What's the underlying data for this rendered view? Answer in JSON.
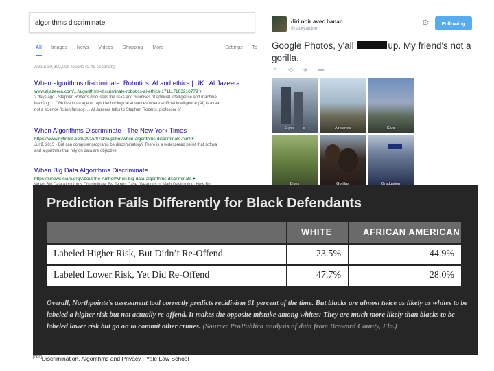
{
  "search": {
    "query": "algorithms discriminate",
    "tabs": [
      "All",
      "Images",
      "News",
      "Videos",
      "Shopping",
      "More"
    ],
    "settings_label": "Settings",
    "tools_label": "To",
    "result_count": "About 30,800,000 results (0.49 seconds)",
    "results": [
      {
        "title": "When algorithms discriminate: Robotics, AI and ethics | UK | Al Jazeera",
        "url": "www.aljazeera.com/.../algorithms-discriminate-robotics-ai-ethics-171117103216779 ▾",
        "snippet_1": "2 days ago - Stephen Roberts discusses the risks and promises of artificial intelligence and machine",
        "snippet_2": "learning. ... \"We live in an age of rapid technological advances where artificial intelligence (AI) is a real",
        "snippet_3": "not a science fiction fantasy. ... Al Jazeera talks to Stephen Roberts, professor of"
      },
      {
        "title": "When Algorithms Discriminate - The New York Times",
        "url": "https://www.nytimes.com/2015/07/10/upshot/when-algorithms-discriminate.html ▾",
        "snippet_1": "Jul 9, 2015 - But can computer programs be discriminatory? There is a widespread belief that softwa",
        "snippet_2": "and algorithms that rely on data are objective.",
        "snippet_3": ""
      },
      {
        "title": "When Big Data Algorithms Discriminate",
        "url": "https://sinews.siam.org/About-the-Author/when-big-data-algorithms-discriminate ▾",
        "snippet_1": "When Big Data Algorithms Discriminate. By James Case. Weapons of Math Destruction: How Big",
        "snippet_2": "",
        "snippet_3": ""
      }
    ]
  },
  "tweet": {
    "name": "diri noir avec banan",
    "handle": "@jackyalcine",
    "follow_label": "Following",
    "text_before": "Google Photos, y'all",
    "text_after": "up. My friend's not a gorilla.",
    "actions": [
      "↰",
      "⟲",
      "★",
      "•••"
    ],
    "photos": [
      {
        "label": "Skyscrapers"
      },
      {
        "label": "Airplanes"
      },
      {
        "label": "Cars"
      },
      {
        "label": "Bikes"
      },
      {
        "label": "Gorillas"
      },
      {
        "label": "Graduation"
      }
    ]
  },
  "propublica": {
    "title": "Prediction Fails Differently for Black Defendants",
    "headers": [
      "",
      "WHITE",
      "AFRICAN AMERICAN"
    ],
    "rows": [
      {
        "label": "Labeled Higher Risk, But Didn’t Re-Offend",
        "white": "23.5%",
        "african_american": "44.9%"
      },
      {
        "label": "Labeled Lower Risk, Yet Did Re-Offend",
        "white": "47.7%",
        "african_american": "28.0%"
      }
    ],
    "note": "Overall, Northpointe’s assessment tool correctly predicts recidivism 61 percent of the time. But blacks are almost twice as likely as whites to be labeled a higher risk but not actually re-offend. It makes the opposite mistake among whites: They are much more likely than blacks to be labeled lower risk but go on to commit other crimes.",
    "source": "(Source: ProPublica analysis of data from Broward County, Fla.)"
  },
  "footer": {
    "sup": "[PDF]",
    "text": "Discrimination, Algorithms and Privacy - Yale Law School"
  }
}
